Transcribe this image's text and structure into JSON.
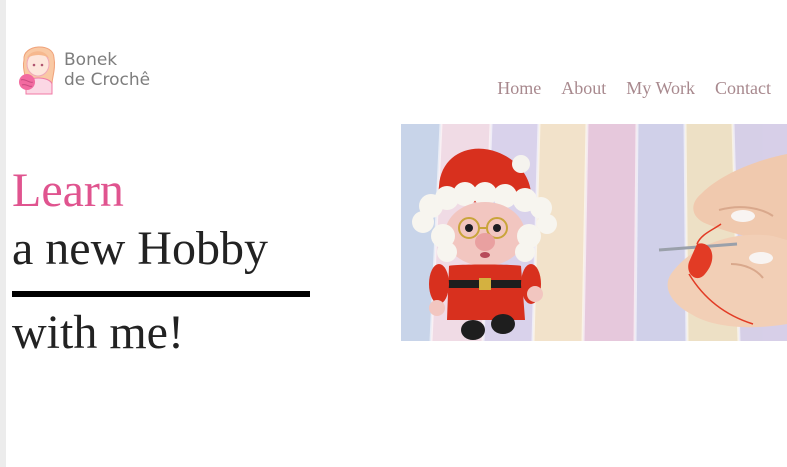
{
  "brand": {
    "line1": "Bonek",
    "line2": "de Crochê"
  },
  "nav": {
    "items": [
      {
        "label": "Home"
      },
      {
        "label": "About"
      },
      {
        "label": "My Work"
      },
      {
        "label": "Contact"
      }
    ]
  },
  "hero": {
    "highlight": "Learn",
    "line2": "a new Hobby",
    "line3": "with me!",
    "accent_color": "#e0548f"
  },
  "icons": {
    "logo": "girl-face-icon",
    "image": "crochet-santa-photo"
  }
}
